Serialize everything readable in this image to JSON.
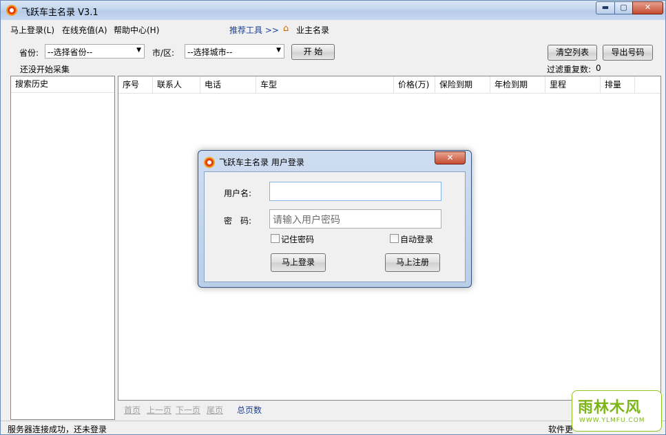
{
  "window": {
    "title": "飞跃车主名录 V3.1",
    "min_glyph": "▬",
    "max_glyph": "▢",
    "close_glyph": "✕"
  },
  "menu": {
    "login": "马上登录(L)",
    "recharge": "在线充值(A)",
    "help": "帮助中心(H)",
    "recommend": "推荐工具 >>",
    "owner_list": "业主名录"
  },
  "filters": {
    "province_label": "省份:",
    "province_value": "--选择省份--",
    "city_label": "市/区:",
    "city_value": "--选择城市--",
    "start_button": "开 始",
    "clear_button": "清空列表",
    "export_button": "导出号码"
  },
  "status_line": {
    "collect": "还没开始采集",
    "dedupe_label": "过滤重复数:",
    "dedupe_count": "0"
  },
  "history": {
    "header": "搜索历史"
  },
  "table": {
    "columns": [
      "序号",
      "联系人",
      "电话",
      "车型",
      "价格(万)",
      "保险到期",
      "年检到期",
      "里程",
      "排量"
    ]
  },
  "pager": {
    "first": "首页",
    "prev": "上一页",
    "next": "下一页",
    "last": "尾页",
    "total": "总页数"
  },
  "statusbar": {
    "left": "服务器连接成功，还未登录",
    "right": "软件更"
  },
  "dialog": {
    "title": "飞跃车主名录 用户登录",
    "username_label": "用户名:",
    "username_value": "",
    "password_label": "密　码:",
    "password_placeholder": "请输入用户密码",
    "remember": "记住密码",
    "auto_login": "自动登录",
    "login_button": "马上登录",
    "register_button": "马上注册",
    "close_glyph": "✕"
  },
  "watermark": {
    "main": "雨林木风",
    "sub": "WWW.YLMFU.COM"
  },
  "colors": {
    "accent_link": "#1a3f95",
    "watermark_green": "#7cb518"
  }
}
